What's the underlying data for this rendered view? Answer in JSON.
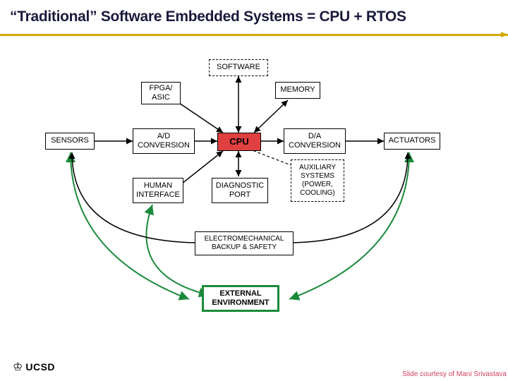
{
  "title": "“Traditional” Software Embedded Systems = CPU + RTOS",
  "boxes": {
    "software": "SOFTWARE",
    "fpga": "FPGA/\nASIC",
    "memory": "MEMORY",
    "sensors": "SENSORS",
    "ad": "A/D\nCONVERSION",
    "cpu": "CPU",
    "da": "D/A\nCONVERSION",
    "actuators": "ACTUATORS",
    "human": "HUMAN\nINTERFACE",
    "diag": "DIAGNOSTIC\nPORT",
    "aux": "AUXILIARY\nSYSTEMS\n(POWER,\nCOOLING)",
    "backup": "ELECTROMECHANICAL\nBACKUP & SAFETY",
    "env": "EXTERNAL\nENVIRONMENT"
  },
  "footer": {
    "logo": "UCSD",
    "attribution": "Slide courtesy of Mani Srivastava"
  }
}
